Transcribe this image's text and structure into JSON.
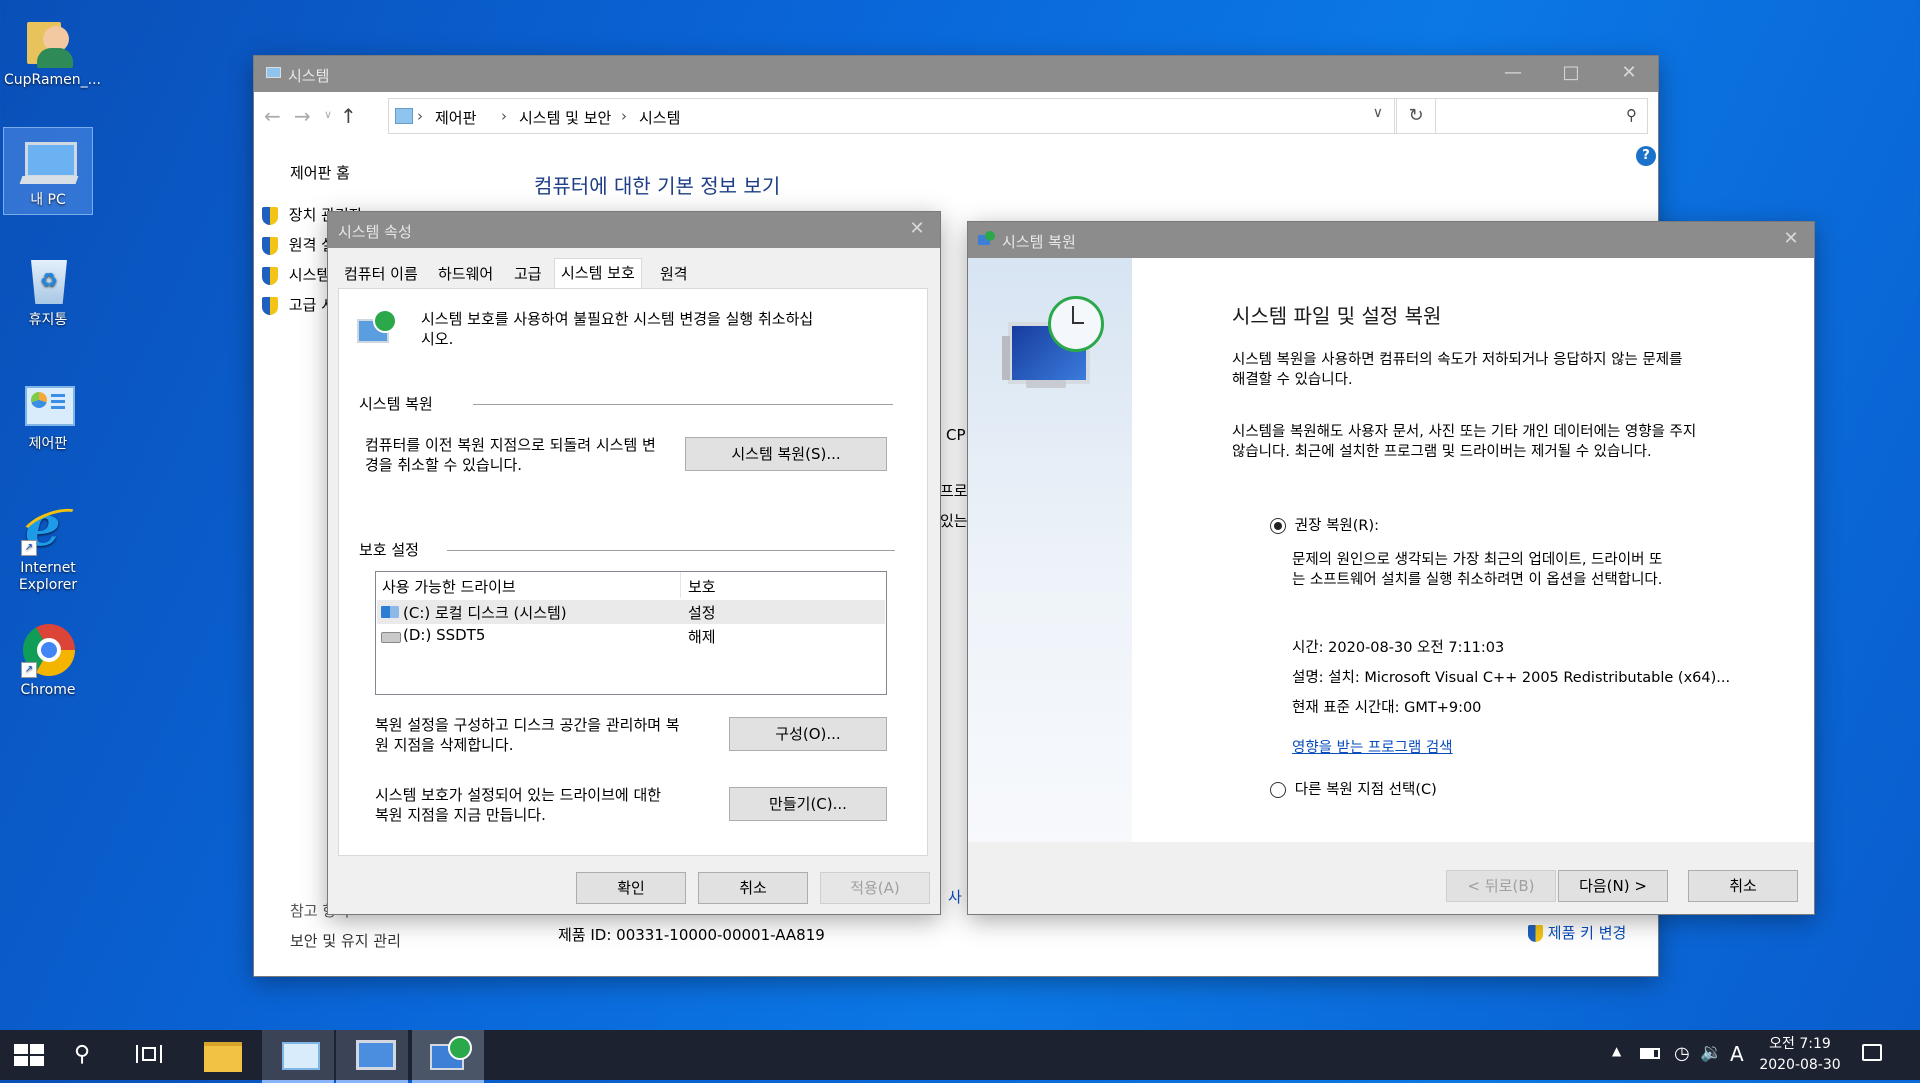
{
  "desktop": {
    "icons": [
      {
        "label": "CupRamen_..."
      },
      {
        "label": "내 PC"
      },
      {
        "label": "휴지통"
      },
      {
        "label": "제어판"
      },
      {
        "label": "Internet\nExplorer",
        "l1": "Internet",
        "l2": "Explorer"
      },
      {
        "label": "Chrome"
      }
    ]
  },
  "system_window": {
    "title": "시스템",
    "breadcrumb": [
      "제어판",
      "시스템 및 보안",
      "시스템"
    ],
    "sidebar_home": "제어판 홈",
    "sidebar_links": [
      "장치 관리자",
      "원격 설정",
      "시스템 보호",
      "고급 시스템 설정"
    ],
    "heading": "컴퓨터에 대한 기본 정보 보기",
    "see_also": "참고 항목",
    "security_link": "보안 및 유지 관리",
    "product_id": "제품 ID: 00331-10000-00001-AA819",
    "change_key": "제품 키 변경",
    "partial_texts": [
      "CP",
      "프로",
      "있는",
      "사"
    ]
  },
  "sys_props": {
    "title": "시스템 속성",
    "tabs": [
      "컴퓨터 이름",
      "하드웨어",
      "고급",
      "시스템 보호",
      "원격"
    ],
    "active_tab": "시스템 보호",
    "intro": "시스템 보호를 사용하여 불필요한 시스템 변경을 실행 취소하십",
    "intro2": "시오.",
    "restore_section": "시스템 복원",
    "restore_desc1": "컴퓨터를 이전 복원 지점으로 되돌려 시스템 변",
    "restore_desc2": "경을 취소할 수 있습니다.",
    "restore_button": "시스템 복원(S)...",
    "protect_section": "보호 설정",
    "col_drive": "사용 가능한 드라이브",
    "col_protect": "보호",
    "drives": [
      {
        "name": "(C:) 로컬 디스크 (시스템)",
        "status": "설정"
      },
      {
        "name": "(D:) SSDT5",
        "status": "해제"
      }
    ],
    "config_desc1": "복원 설정을 구성하고 디스크 공간을 관리하며 복",
    "config_desc2": "원 지점을 삭제합니다.",
    "config_button": "구성(O)...",
    "create_desc1": "시스템 보호가 설정되어 있는 드라이브에 대한",
    "create_desc2": "복원 지점을 지금 만듭니다.",
    "create_button": "만들기(C)...",
    "ok": "확인",
    "cancel": "취소",
    "apply": "적용(A)"
  },
  "restore_wizard": {
    "title": "시스템 복원",
    "heading": "시스템 파일 및 설정 복원",
    "p1a": "시스템 복원을 사용하면 컴퓨터의 속도가 저하되거나 응답하지 않는 문제를",
    "p1b": "해결할 수 있습니다.",
    "p2a": "시스템을 복원해도 사용자 문서, 사진 또는 기타 개인 데이터에는 영향을 주지",
    "p2b": "않습니다. 최근에 설치한 프로그램 및 드라이버는 제거될 수 있습니다.",
    "opt_recommended": "권장 복원(R):",
    "rec_desc1": "문제의 원인으로 생각되는 가장 최근의 업데이트, 드라이버 또",
    "rec_desc2": "는 소프트웨어 설치를 실행 취소하려면 이 옵션을 선택합니다.",
    "time": "시간: 2020-08-30 오전 7:11:03",
    "desc": "설명: 설치: Microsoft Visual C++ 2005 Redistributable (x64)...",
    "tz": "현재 표준 시간대: GMT+9:00",
    "scan_link": "영향을 받는 프로그램 검색",
    "opt_other": "다른 복원 지점 선택(C)",
    "back": "< 뒤로(B)",
    "next": "다음(N) >",
    "cancel": "취소"
  },
  "taskbar": {
    "time": "오전 7:19",
    "date": "2020-08-30",
    "ime": "A"
  }
}
